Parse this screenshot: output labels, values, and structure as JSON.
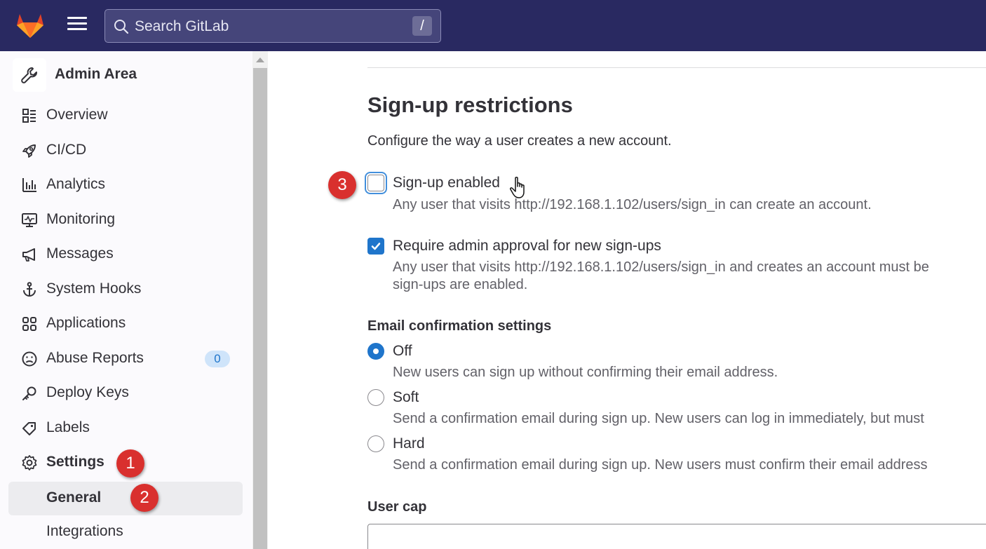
{
  "topbar": {
    "search_placeholder": "Search GitLab",
    "search_shortcut": "/"
  },
  "sidebar": {
    "title": "Admin Area",
    "items": [
      {
        "label": "Overview",
        "icon": "overview-icon"
      },
      {
        "label": "CI/CD",
        "icon": "rocket-icon"
      },
      {
        "label": "Analytics",
        "icon": "chart-icon"
      },
      {
        "label": "Monitoring",
        "icon": "monitor-icon"
      },
      {
        "label": "Messages",
        "icon": "megaphone-icon"
      },
      {
        "label": "System Hooks",
        "icon": "anchor-icon"
      },
      {
        "label": "Applications",
        "icon": "applications-icon"
      },
      {
        "label": "Abuse Reports",
        "icon": "abuse-icon",
        "badge": "0"
      },
      {
        "label": "Deploy Keys",
        "icon": "key-icon"
      },
      {
        "label": "Labels",
        "icon": "label-icon"
      },
      {
        "label": "Settings",
        "icon": "gear-icon"
      }
    ],
    "subitems": [
      {
        "label": "General"
      },
      {
        "label": "Integrations"
      }
    ]
  },
  "markers": [
    "1",
    "2",
    "3"
  ],
  "main": {
    "heading": "Sign-up restrictions",
    "description": "Configure the way a user creates a new account.",
    "signup_enabled": {
      "label": "Sign-up enabled",
      "help": "Any user that visits http://192.168.1.102/users/sign_in can create an account.",
      "checked": false
    },
    "admin_approval": {
      "label": "Require admin approval for new sign-ups",
      "help_line1": "Any user that visits http://192.168.1.102/users/sign_in and creates an account must be",
      "help_line2": "sign-ups are enabled.",
      "checked": true
    },
    "email_confirmation": {
      "title": "Email confirmation settings",
      "options": [
        {
          "label": "Off",
          "help": "New users can sign up without confirming their email address.",
          "selected": true
        },
        {
          "label": "Soft",
          "help": "Send a confirmation email during sign up. New users can log in immediately, but must",
          "selected": false
        },
        {
          "label": "Hard",
          "help": "Send a confirmation email during sign up. New users must confirm their email address",
          "selected": false
        }
      ]
    },
    "user_cap": {
      "title": "User cap",
      "value": ""
    }
  },
  "colors": {
    "topbar": "#292961",
    "accent": "#1f75cb",
    "marker": "#d9302e"
  }
}
